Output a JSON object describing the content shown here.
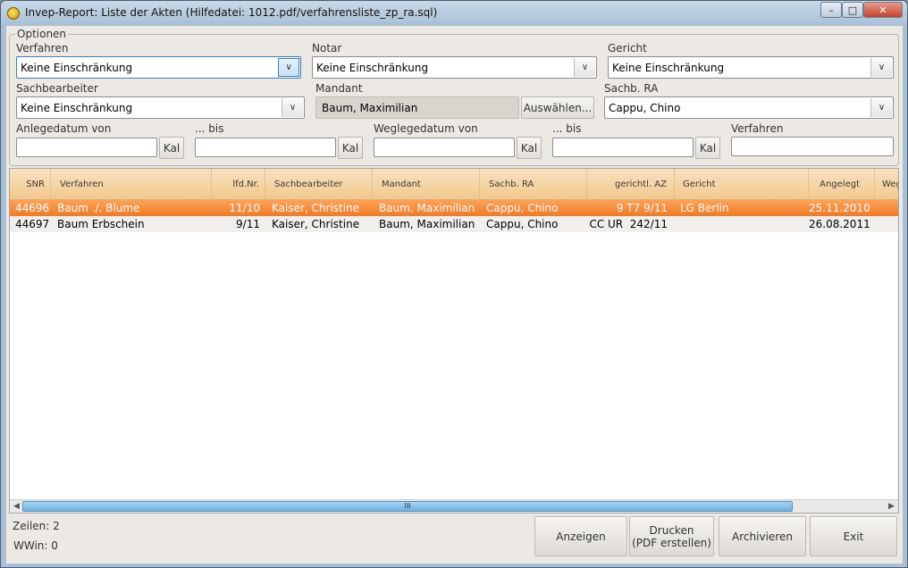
{
  "window": {
    "title": "Invep-Report: Liste der Akten   (Hilfedatei: 1012.pdf/verfahrensliste_zp_ra.sql)"
  },
  "options": {
    "legend": "Optionen",
    "verfahren": {
      "label": "Verfahren",
      "value": "Keine Einschränkung"
    },
    "notar": {
      "label": "Notar",
      "value": "Keine Einschränkung"
    },
    "gericht": {
      "label": "Gericht",
      "value": "Keine Einschränkung"
    },
    "sachbearbeiter": {
      "label": "Sachbearbeiter",
      "value": "Keine Einschränkung"
    },
    "mandant": {
      "label": "Mandant",
      "value": "Baum, Maximilian",
      "select_label": "Auswählen..."
    },
    "sachb_ra": {
      "label": "Sachb. RA",
      "value": "Cappu, Chino"
    },
    "anlegedatum_von": {
      "label": "Anlegedatum von",
      "value": "",
      "kal": "Kal"
    },
    "anlegedatum_bis": {
      "label": "... bis",
      "value": "",
      "kal": "Kal"
    },
    "weglegedatum_von": {
      "label": "Weglegedatum von",
      "value": "",
      "kal": "Kal"
    },
    "weglegedatum_bis": {
      "label": "... bis",
      "value": "",
      "kal": "Kal"
    },
    "verfahren_text": {
      "label": "Verfahren",
      "value": ""
    }
  },
  "table": {
    "headers": [
      "SNR",
      "Verfahren",
      "lfd.Nr.",
      "Sachbearbeiter",
      "Mandant",
      "Sachb. RA",
      "gerichtl. AZ",
      "Gericht",
      "Angelegt",
      "Weg"
    ],
    "rows": [
      [
        "44696",
        "Baum ./. Blume",
        "11/10",
        "Kaiser, Christine",
        "Baum, Maximilian",
        "Cappu, Chino",
        "9 T7 9/11",
        "LG Berlin",
        "25.11.2010",
        ""
      ],
      [
        "44697",
        "Baum Erbschein",
        "9/11",
        "Kaiser, Christine",
        "Baum, Maximilian",
        "Cappu, Chino",
        "CC UR  242/11",
        "",
        "26.08.2011",
        ""
      ]
    ],
    "selected_row": 0,
    "scroll_grip": "III"
  },
  "status": {
    "zeilen": "Zeilen: 2",
    "wwin": "WWin: 0"
  },
  "buttons": {
    "anzeigen": "Anzeigen",
    "drucken_line1": "Drucken",
    "drucken_line2": "(PDF erstellen)",
    "archivieren": "Archivieren",
    "exit": "Exit"
  },
  "colors": {
    "header_bg": "#f2c98d",
    "selected_row": "#ef7a25",
    "scroll_thumb": "#6fb2e2"
  }
}
